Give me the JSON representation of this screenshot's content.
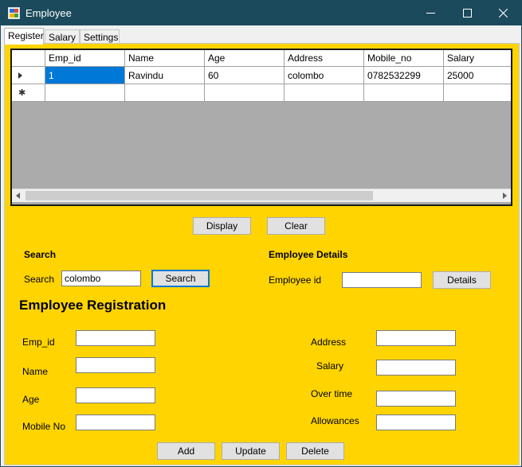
{
  "window": {
    "title": "Employee"
  },
  "tabs": [
    "Register",
    "Salary",
    "Settings"
  ],
  "grid": {
    "columns": [
      "Emp_id",
      "Name",
      "Age",
      "Address",
      "Mobile_no",
      "Salary"
    ],
    "rows": [
      [
        "1",
        "Ravindu",
        "60",
        "colombo",
        "0782532299",
        "25000"
      ]
    ]
  },
  "buttons": {
    "display": "Display",
    "clear": "Clear",
    "search": "Search",
    "details": "Details",
    "add": "Add",
    "update": "Update",
    "delete": "Delete"
  },
  "search": {
    "heading": "Search",
    "label": "Search",
    "value": "colombo"
  },
  "details": {
    "heading": "Employee Details",
    "label": "Employee id",
    "value": ""
  },
  "registration": {
    "heading": "Employee Registration",
    "left_labels": [
      "Emp_id",
      "Name",
      "Age",
      "Mobile No"
    ],
    "right_labels": [
      "Address",
      "Salary",
      "Over time",
      "Allowances"
    ]
  }
}
